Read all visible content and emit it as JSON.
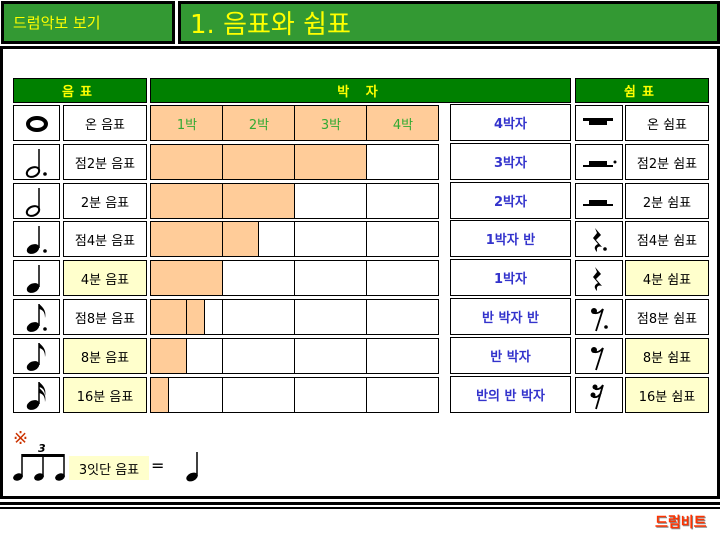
{
  "header": {
    "section": "드럼악보 보기",
    "title": "1. 음표와 쉼표"
  },
  "columns": {
    "notes": "음표",
    "beats": "박 자",
    "rests": "쉼표"
  },
  "beat_headers": [
    "1박",
    "2박",
    "3박",
    "4박"
  ],
  "rows": [
    {
      "note_icon": "whole-note-icon",
      "note": "온 음표",
      "beats": 4,
      "segments": [
        4
      ],
      "beat_label": "4박자",
      "rest_icon": "whole-rest-icon",
      "rest": "온 쉼표",
      "highlight": false
    },
    {
      "note_icon": "dotted-half-note-icon",
      "note": "점2분 음표",
      "beats": 3,
      "segments": [
        1,
        1,
        1
      ],
      "beat_label": "3박자",
      "rest_icon": "dotted-half-rest-icon",
      "rest": "점2분 쉼표",
      "highlight": false
    },
    {
      "note_icon": "half-note-icon",
      "note": "2분 음표",
      "beats": 2,
      "segments": [
        1,
        1
      ],
      "beat_label": "2박자",
      "rest_icon": "half-rest-icon",
      "rest": "2분 쉼표",
      "highlight": false
    },
    {
      "note_icon": "dotted-quarter-note-icon",
      "note": "점4분 음표",
      "beats": 1.5,
      "segments": [
        1,
        0.5
      ],
      "beat_label": "1박자 반",
      "rest_icon": "dotted-quarter-rest-icon",
      "rest": "점4분 쉼표",
      "highlight": false
    },
    {
      "note_icon": "quarter-note-icon",
      "note": "4분 음표",
      "beats": 1,
      "segments": [
        1
      ],
      "beat_label": "1박자",
      "rest_icon": "quarter-rest-icon",
      "rest": "4분 쉼표",
      "highlight": true
    },
    {
      "note_icon": "dotted-eighth-note-icon",
      "note": "점8분 음표",
      "beats": 0.75,
      "segments": [
        0.5,
        0.25
      ],
      "beat_label": "반 박자 반",
      "rest_icon": "dotted-eighth-rest-icon",
      "rest": "점8분 쉼표",
      "highlight": false
    },
    {
      "note_icon": "eighth-note-icon",
      "note": "8분 음표",
      "beats": 0.5,
      "segments": [
        0.5
      ],
      "beat_label": "반 박자",
      "rest_icon": "eighth-rest-icon",
      "rest": "8분 쉼표",
      "highlight": true
    },
    {
      "note_icon": "sixteenth-note-icon",
      "note": "16분 음표",
      "beats": 0.25,
      "segments": [
        0.25
      ],
      "beat_label": "반의 반 박자",
      "rest_icon": "sixteenth-rest-icon",
      "rest": "16분 쉼표",
      "highlight": true
    }
  ],
  "note_mark": "※",
  "triplet": {
    "number": "3",
    "label": "3잇단 음표",
    "equals": "="
  },
  "logo": "드럼비트",
  "colors": {
    "green": "#339933",
    "header_green": "#008000",
    "yellow_text": "#ffff00",
    "beat_fill": "#ffcc99",
    "highlight": "#ffffcc",
    "beat_label": "#3333cc"
  }
}
